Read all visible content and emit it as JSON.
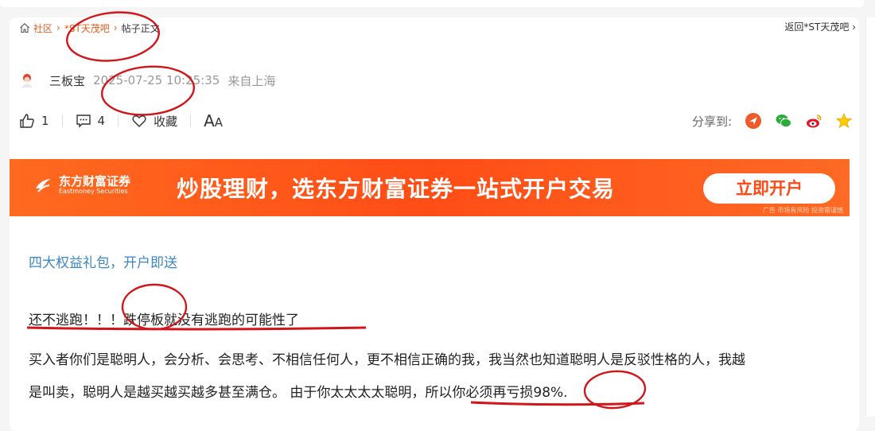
{
  "breadcrumb": {
    "home": "社区",
    "forum": "*ST天茂吧",
    "current": "帖子正文"
  },
  "back_link": "返回*ST天茂吧",
  "author": {
    "name": "三板宝",
    "time": "2025-07-25 10:25:35",
    "location": "来自上海"
  },
  "actions": {
    "likes": "1",
    "comments": "4",
    "favorite": "收藏",
    "font_big": "A",
    "font_small": "A"
  },
  "share": {
    "label": "分享到:",
    "icons": [
      "send-icon",
      "wechat-icon",
      "weibo-icon",
      "star-icon"
    ]
  },
  "banner": {
    "brand_cn": "东方财富证券",
    "brand_en": "Eastmoney Securities",
    "slogan": "炒股理财，选东方财富证券一站式开户交易",
    "button": "立即开户",
    "disclaimer": "广告 市场有风险 投资需谨慎"
  },
  "promo_link": "四大权益礼包，开户即送",
  "post": {
    "title": "还不逃跑！！！跌停板就没有逃跑的可能性了",
    "line1": "买入者你们是聪明人，会分析、会思考、不相信任何人，更不相信正确的我，我当然也知道聪明人是反驳性格的人，我越",
    "line2": "是叫卖，聪明人是越买越买越多甚至满仓。 由于你太太太太聪明，所以你必须再亏损98%."
  },
  "colors": {
    "accent": "#e85c1d",
    "link": "#3d86c6",
    "banner": "#ff5a1a",
    "annotation": "#d0161a"
  }
}
